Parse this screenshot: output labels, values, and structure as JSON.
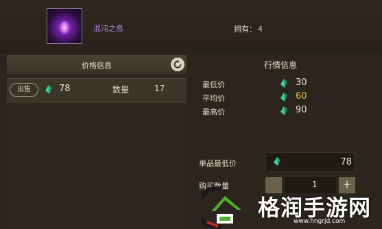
{
  "item": {
    "name": "混沌之息",
    "own_label": "拥有：",
    "own_count": "4"
  },
  "left_panel": {
    "title": "价格信息",
    "sell_label": "出售",
    "price": "78",
    "qty_label": "数量",
    "qty_value": "17"
  },
  "right_panel": {
    "title": "行情信息",
    "rows": [
      {
        "label": "最低价",
        "value": "30",
        "color": "#e8dfc8"
      },
      {
        "label": "平均价",
        "value": "60",
        "color": "#e2c640"
      },
      {
        "label": "最高价",
        "value": "90",
        "color": "#e8dfc8"
      }
    ],
    "unit_min_label": "单品最低价",
    "unit_min_value": "78",
    "purchase_qty_label": "购买数量",
    "purchase_qty_value": "1",
    "plus_label": "+"
  },
  "watermark": {
    "text": "格润手游网",
    "url": "www.hngrjd.com"
  },
  "icons": {
    "gem": "green-gem-icon",
    "refresh": "refresh-icon"
  }
}
